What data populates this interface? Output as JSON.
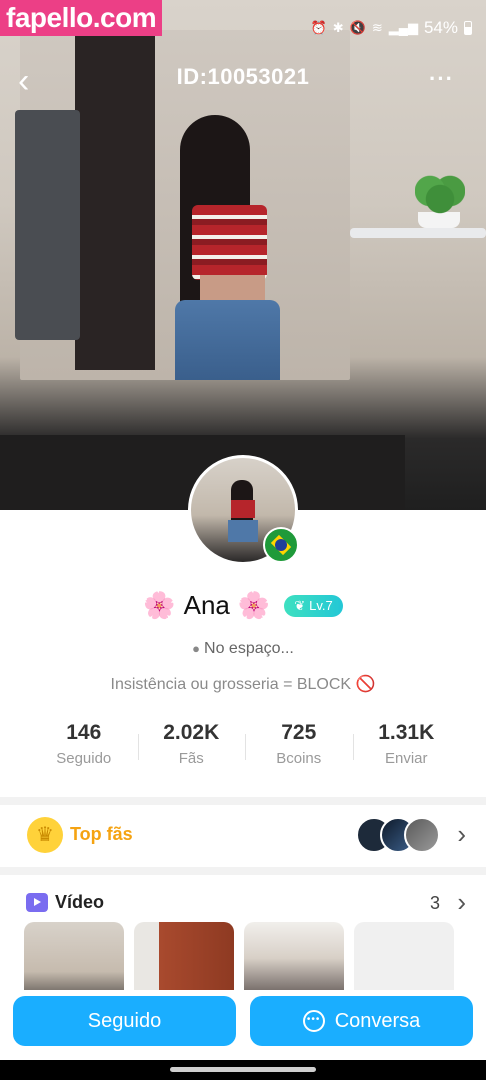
{
  "watermark": "fapello.com",
  "statusbar": {
    "battery": "54%"
  },
  "header": {
    "user_id": "ID:10053021",
    "more": "···"
  },
  "profile": {
    "name": "Ana",
    "blossom": "🌸",
    "level": "Lv.7",
    "location": "No espaço...",
    "bio": "Insistência ou grosseria = BLOCK",
    "bio_emoji": "🚫"
  },
  "stats": [
    {
      "value": "146",
      "label": "Seguido"
    },
    {
      "value": "2.02K",
      "label": "Fãs"
    },
    {
      "value": "725",
      "label": "Bcoins"
    },
    {
      "value": "1.31K",
      "label": "Enviar"
    }
  ],
  "top_fans": {
    "title": "Top fãs"
  },
  "video": {
    "title": "Vídeo",
    "count": "3"
  },
  "buttons": {
    "follow": "Seguido",
    "chat": "Conversa"
  },
  "icons": {
    "back": "chevron-left-icon",
    "more": "more-dots-icon",
    "location": "map-pin-icon",
    "crown": "crown-icon",
    "video": "tv-play-icon",
    "chat": "chat-bubble-icon",
    "flag": "brazil-flag-icon"
  },
  "colors": {
    "primary_button": "#1aaeff",
    "top_fans": "#f5a312",
    "level_badge": "#2fd4c8"
  }
}
